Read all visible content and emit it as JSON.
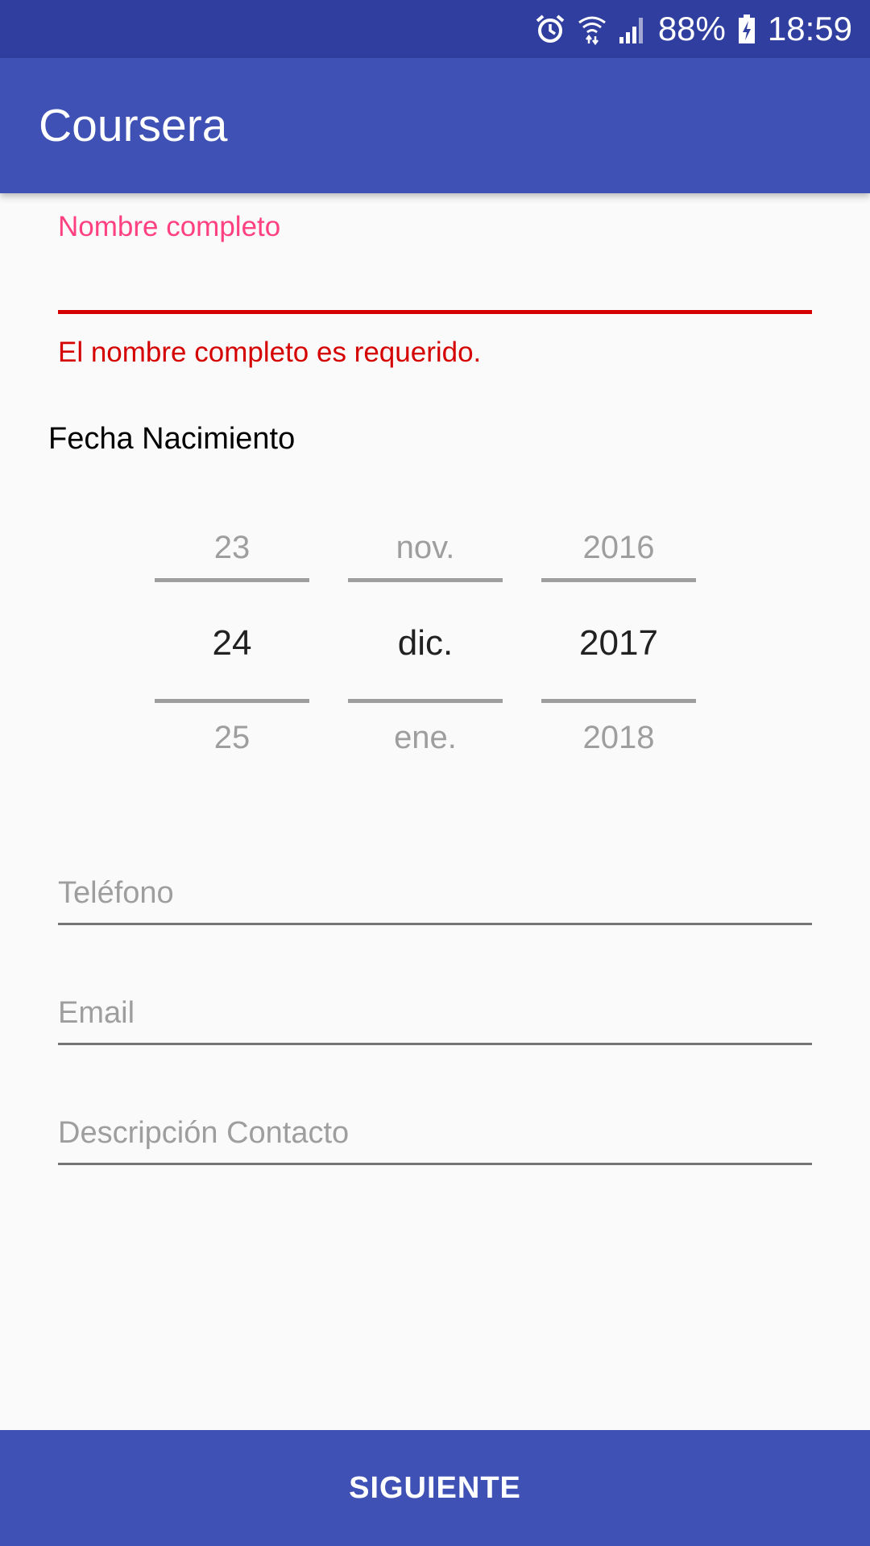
{
  "status_bar": {
    "battery_text": "88%",
    "time": "18:59",
    "icons": [
      "alarm-icon",
      "wifi-icon",
      "signal-icon",
      "battery-charging-icon"
    ]
  },
  "app_bar": {
    "title": "Coursera"
  },
  "form": {
    "name_field": {
      "label": "Nombre completo",
      "value": "",
      "error": "El nombre completo es requerido."
    },
    "birth_date": {
      "label": "Fecha Nacimiento",
      "day": {
        "prev": "23",
        "current": "24",
        "next": "25"
      },
      "month": {
        "prev": "nov.",
        "current": "dic.",
        "next": "ene."
      },
      "year": {
        "prev": "2016",
        "current": "2017",
        "next": "2018"
      }
    },
    "phone_field": {
      "placeholder": "Teléfono",
      "value": ""
    },
    "email_field": {
      "placeholder": "Email",
      "value": ""
    },
    "description_field": {
      "placeholder": "Descripción Contacto",
      "value": ""
    }
  },
  "actions": {
    "next_label": "SIGUIENTE"
  },
  "colors": {
    "status_bar": "#303f9f",
    "primary": "#3f51b5",
    "accent": "#ff4081",
    "error": "#d50000"
  }
}
